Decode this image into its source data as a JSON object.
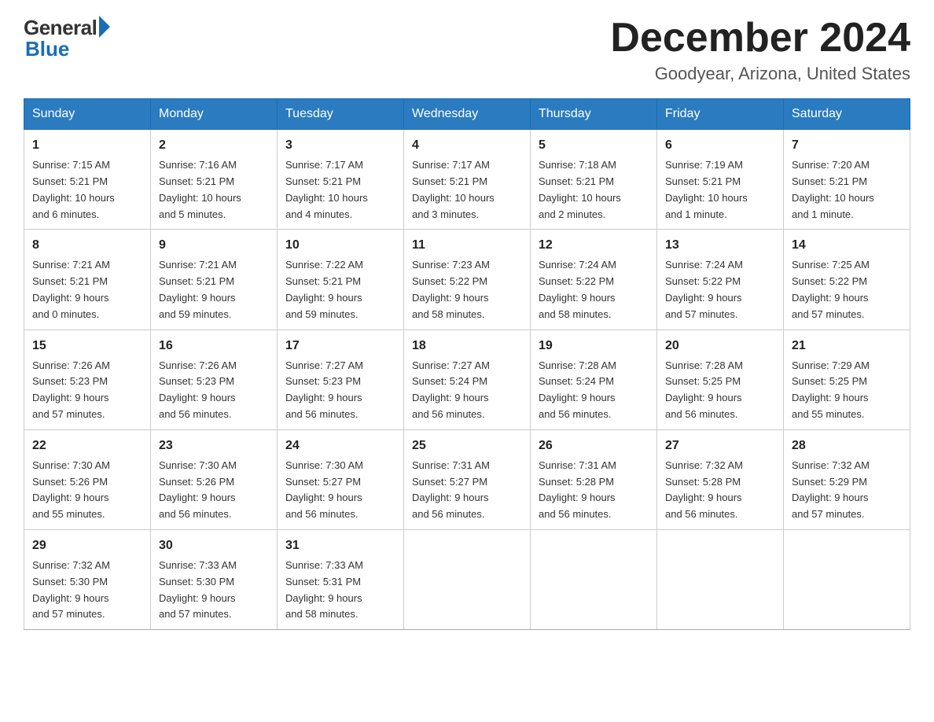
{
  "header": {
    "logo_general": "General",
    "logo_blue": "Blue",
    "title": "December 2024",
    "location": "Goodyear, Arizona, United States"
  },
  "weekdays": [
    "Sunday",
    "Monday",
    "Tuesday",
    "Wednesday",
    "Thursday",
    "Friday",
    "Saturday"
  ],
  "weeks": [
    [
      {
        "day": "1",
        "sunrise": "7:15 AM",
        "sunset": "5:21 PM",
        "daylight": "10 hours and 6 minutes."
      },
      {
        "day": "2",
        "sunrise": "7:16 AM",
        "sunset": "5:21 PM",
        "daylight": "10 hours and 5 minutes."
      },
      {
        "day": "3",
        "sunrise": "7:17 AM",
        "sunset": "5:21 PM",
        "daylight": "10 hours and 4 minutes."
      },
      {
        "day": "4",
        "sunrise": "7:17 AM",
        "sunset": "5:21 PM",
        "daylight": "10 hours and 3 minutes."
      },
      {
        "day": "5",
        "sunrise": "7:18 AM",
        "sunset": "5:21 PM",
        "daylight": "10 hours and 2 minutes."
      },
      {
        "day": "6",
        "sunrise": "7:19 AM",
        "sunset": "5:21 PM",
        "daylight": "10 hours and 1 minute."
      },
      {
        "day": "7",
        "sunrise": "7:20 AM",
        "sunset": "5:21 PM",
        "daylight": "10 hours and 1 minute."
      }
    ],
    [
      {
        "day": "8",
        "sunrise": "7:21 AM",
        "sunset": "5:21 PM",
        "daylight": "9 hours and 0 minutes."
      },
      {
        "day": "9",
        "sunrise": "7:21 AM",
        "sunset": "5:21 PM",
        "daylight": "9 hours and 59 minutes."
      },
      {
        "day": "10",
        "sunrise": "7:22 AM",
        "sunset": "5:21 PM",
        "daylight": "9 hours and 59 minutes."
      },
      {
        "day": "11",
        "sunrise": "7:23 AM",
        "sunset": "5:22 PM",
        "daylight": "9 hours and 58 minutes."
      },
      {
        "day": "12",
        "sunrise": "7:24 AM",
        "sunset": "5:22 PM",
        "daylight": "9 hours and 58 minutes."
      },
      {
        "day": "13",
        "sunrise": "7:24 AM",
        "sunset": "5:22 PM",
        "daylight": "9 hours and 57 minutes."
      },
      {
        "day": "14",
        "sunrise": "7:25 AM",
        "sunset": "5:22 PM",
        "daylight": "9 hours and 57 minutes."
      }
    ],
    [
      {
        "day": "15",
        "sunrise": "7:26 AM",
        "sunset": "5:23 PM",
        "daylight": "9 hours and 57 minutes."
      },
      {
        "day": "16",
        "sunrise": "7:26 AM",
        "sunset": "5:23 PM",
        "daylight": "9 hours and 56 minutes."
      },
      {
        "day": "17",
        "sunrise": "7:27 AM",
        "sunset": "5:23 PM",
        "daylight": "9 hours and 56 minutes."
      },
      {
        "day": "18",
        "sunrise": "7:27 AM",
        "sunset": "5:24 PM",
        "daylight": "9 hours and 56 minutes."
      },
      {
        "day": "19",
        "sunrise": "7:28 AM",
        "sunset": "5:24 PM",
        "daylight": "9 hours and 56 minutes."
      },
      {
        "day": "20",
        "sunrise": "7:28 AM",
        "sunset": "5:25 PM",
        "daylight": "9 hours and 56 minutes."
      },
      {
        "day": "21",
        "sunrise": "7:29 AM",
        "sunset": "5:25 PM",
        "daylight": "9 hours and 55 minutes."
      }
    ],
    [
      {
        "day": "22",
        "sunrise": "7:30 AM",
        "sunset": "5:26 PM",
        "daylight": "9 hours and 55 minutes."
      },
      {
        "day": "23",
        "sunrise": "7:30 AM",
        "sunset": "5:26 PM",
        "daylight": "9 hours and 56 minutes."
      },
      {
        "day": "24",
        "sunrise": "7:30 AM",
        "sunset": "5:27 PM",
        "daylight": "9 hours and 56 minutes."
      },
      {
        "day": "25",
        "sunrise": "7:31 AM",
        "sunset": "5:27 PM",
        "daylight": "9 hours and 56 minutes."
      },
      {
        "day": "26",
        "sunrise": "7:31 AM",
        "sunset": "5:28 PM",
        "daylight": "9 hours and 56 minutes."
      },
      {
        "day": "27",
        "sunrise": "7:32 AM",
        "sunset": "5:28 PM",
        "daylight": "9 hours and 56 minutes."
      },
      {
        "day": "28",
        "sunrise": "7:32 AM",
        "sunset": "5:29 PM",
        "daylight": "9 hours and 57 minutes."
      }
    ],
    [
      {
        "day": "29",
        "sunrise": "7:32 AM",
        "sunset": "5:30 PM",
        "daylight": "9 hours and 57 minutes."
      },
      {
        "day": "30",
        "sunrise": "7:33 AM",
        "sunset": "5:30 PM",
        "daylight": "9 hours and 57 minutes."
      },
      {
        "day": "31",
        "sunrise": "7:33 AM",
        "sunset": "5:31 PM",
        "daylight": "9 hours and 58 minutes."
      },
      null,
      null,
      null,
      null
    ]
  ],
  "labels": {
    "sunrise": "Sunrise:",
    "sunset": "Sunset:",
    "daylight": "Daylight:"
  }
}
